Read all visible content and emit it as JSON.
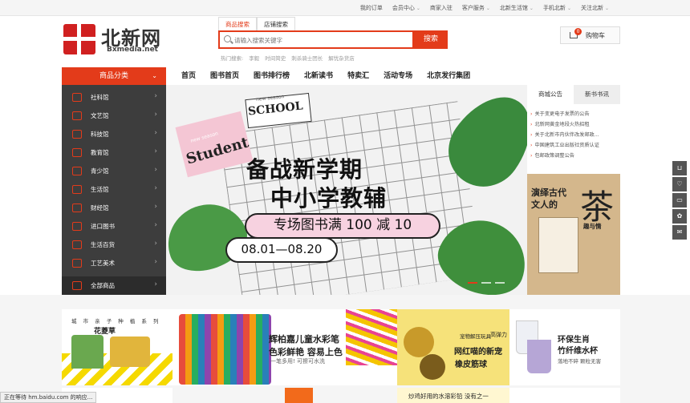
{
  "topbar": {
    "links": [
      "我的订单",
      "会员中心",
      "商家入驻",
      "客户服务",
      "北新生活馆",
      "手机北新",
      "关注北新"
    ],
    "has_caret": [
      false,
      true,
      false,
      true,
      true,
      true,
      true
    ]
  },
  "logo": {
    "name": "北新网",
    "domain": "Bxmedia.net"
  },
  "search": {
    "tabs": [
      "商品搜索",
      "店铺搜索"
    ],
    "placeholder": "请输入搜索关键字",
    "button": "搜索",
    "hot_label": "热门搜索:",
    "hot_words": [
      "李毅",
      "时间简史",
      "刺杀骑士团长",
      "解忧杂货店"
    ]
  },
  "cart": {
    "label": "购物车",
    "count": "0"
  },
  "nav": {
    "category_header": "商品分类",
    "items": [
      "首页",
      "图书首页",
      "图书排行榜",
      "北新读书",
      "特卖汇",
      "活动专场",
      "北京发行集团"
    ]
  },
  "sidebar": {
    "items": [
      "社科馆",
      "文艺馆",
      "科技馆",
      "教育馆",
      "青少馆",
      "生活馆",
      "财经馆",
      "进口图书",
      "生活百货",
      "工艺美术",
      "全部商品"
    ]
  },
  "banner": {
    "tag1": "Student",
    "tag1_small": "new season",
    "tag2": "SCHOOL",
    "tag2_small": "new season",
    "title1": "备战新学期",
    "title2": "中小学教辅",
    "promo": "专场图书满 100 减 10",
    "dates": "08.01—08.20"
  },
  "notice": {
    "tabs": [
      "商城公告",
      "新书书讯"
    ],
    "items": [
      "关于变更电子发票的公告",
      "北新网黄金地段火热招租",
      "关于北新市内伙伴改发邮政...",
      "中国建筑工业出版社资质认证",
      "包邮政策调整公告"
    ]
  },
  "side_ad": {
    "line1": "演绎古代",
    "line2": "文人的",
    "big": "茶",
    "sub": "趣与情"
  },
  "floating_bar": [
    "cart",
    "heart",
    "chat",
    "gift",
    "mail"
  ],
  "promos": {
    "card1": {
      "line1": "城 市 亲 子 种 植 系 列",
      "line2": "花菱草"
    },
    "card2": {
      "line1": "辉柏嘉儿童水彩笔",
      "line2": "色彩鲜艳  容易上色",
      "line3": "一笔多用! 可擦可水洗"
    },
    "card3": {
      "line0": "高弹力",
      "line1": "宠物解压玩具",
      "line2": "网红喵的新宠",
      "line3": "橡皮筋球"
    },
    "card4": {
      "line1": "环保生肖",
      "line2": "竹纤维水杯",
      "line3": "落地不碎  颗粒无害"
    }
  },
  "bottom_row": {
    "text": "炒鸡好用的水溶彩铅  没有之一"
  },
  "status_bar": {
    "text": "正在等待 hm.baidu.com 的响应..."
  }
}
